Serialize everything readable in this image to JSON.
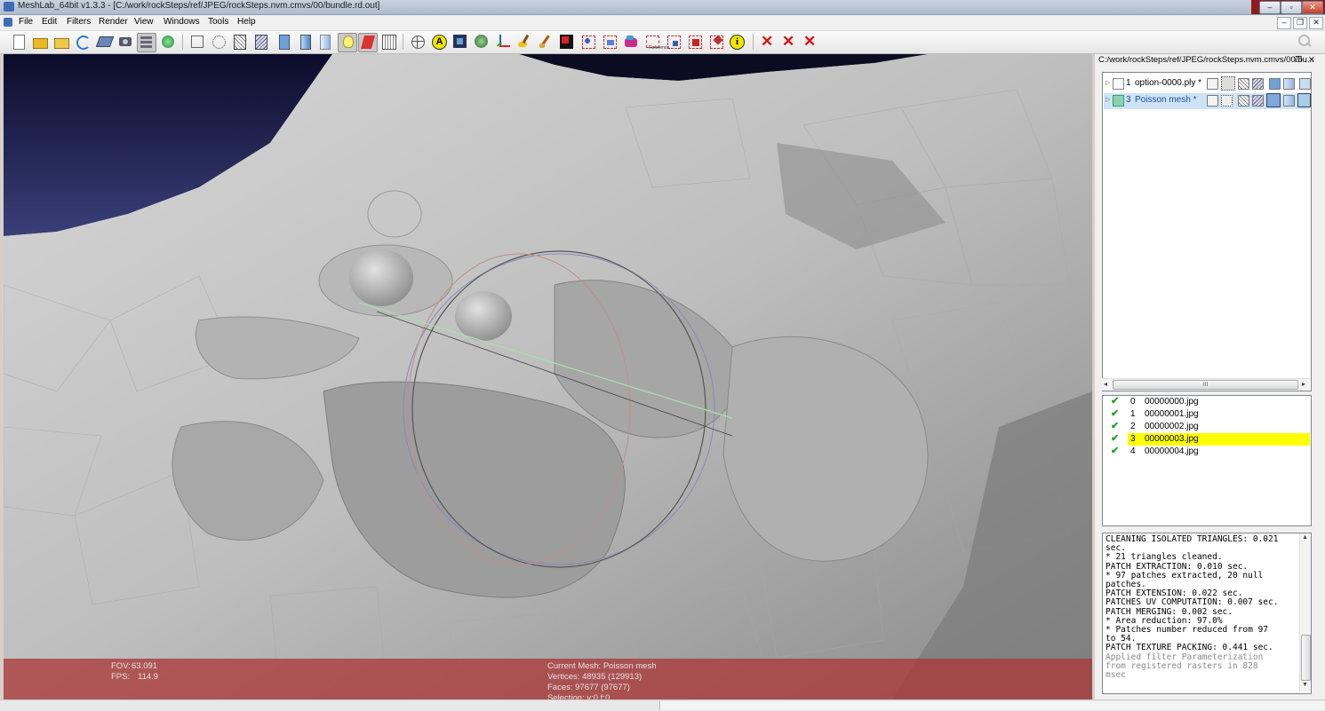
{
  "window": {
    "title": "MeshLab_64bit v1.3.3 - [C:/work/rockSteps/ref/JPEG/rockSteps.nvm.cmvs/00/bundle.rd.out]",
    "controls": [
      "–",
      "▫",
      "✕"
    ]
  },
  "menu": {
    "items": [
      "File",
      "Edit",
      "Filters",
      "Render",
      "View",
      "Windows",
      "Tools",
      "Help"
    ],
    "mdi_controls": [
      "–",
      "❐",
      "✕"
    ]
  },
  "toolbar": {
    "icons": [
      "new-icon",
      "open-icon",
      "open-project-icon",
      "reload-icon",
      "save-icon",
      "snapshot-icon",
      "layers-icon",
      "camera-icon",
      "bbox-icon",
      "points-icon",
      "wireframe-icon",
      "hiddenlines-icon",
      "flat-icon",
      "smooth-icon",
      "lines-icon",
      "light-icon",
      "fancy-light-icon",
      "backface-icon",
      "trackball-icon",
      "annotation-icon",
      "texture-icon",
      "globe-icon",
      "axes-icon",
      "paint-icon",
      "raster-icon",
      "align-icon",
      "select-vertex-icon",
      "paint-color-icon",
      "select-faces-icon",
      "measure-icon",
      "pick-points-icon",
      "info-icon",
      "delete-faces-icon",
      "delete-vertices-icon",
      "delete-all-icon"
    ]
  },
  "viewport": {
    "fov_label": "FOV:",
    "fov": "63.091",
    "fps_label": "FPS:",
    "fps": "114.9",
    "current_mesh": "Current Mesh: Poisson mesh",
    "vertices": "Vertices: 48935 (129913)",
    "faces": "Faces: 97677 (97677)",
    "selection": "Selection: v:0 f:0"
  },
  "panel": {
    "title": "C:/work/rockSteps/ref/JPEG/rockSteps.nvm.cmvs/00/bu...",
    "float_icon": "❐",
    "close_icon": "✕",
    "layers": [
      {
        "id": "1",
        "name": "option-0000.ply *",
        "selected": false
      },
      {
        "id": "3",
        "name": "Poisson mesh *",
        "selected": true
      }
    ],
    "scroll_grip": "III",
    "rasters": [
      {
        "index": "0",
        "name": "00000000.jpg",
        "selected": false
      },
      {
        "index": "1",
        "name": "00000001.jpg",
        "selected": false
      },
      {
        "index": "2",
        "name": "00000002.jpg",
        "selected": false
      },
      {
        "index": "3",
        "name": "00000003.jpg",
        "selected": true
      },
      {
        "index": "4",
        "name": "00000004.jpg",
        "selected": false
      }
    ],
    "raster_check": "✔",
    "log": [
      "CLEANING ISOLATED TRIANGLES: 0.021",
      "sec.",
      "* 21 triangles cleaned.",
      "PATCH EXTRACTION: 0.010 sec.",
      "* 97 patches extracted, 20 null",
      "patches.",
      "PATCH EXTENSION: 0.022 sec.",
      "PATCHES UV COMPUTATION: 0.007 sec.",
      "PATCH MERGING: 0.002 sec.",
      "* Area reduction: 97.0%",
      "* Patches number reduced from 97",
      "to 54.",
      "PATCH TEXTURE PACKING: 0.441 sec."
    ],
    "log_faint": [
      "Applied filter Parameterization",
      "from registered rasters in 828",
      "msec"
    ]
  },
  "colors": {
    "selected_raster": "#ffff00",
    "selected_layer": "#cfe3f7",
    "hud": "#aa3a3a",
    "sky_top": "#0b0c2a",
    "sky_bottom": "#3a3f7a"
  }
}
